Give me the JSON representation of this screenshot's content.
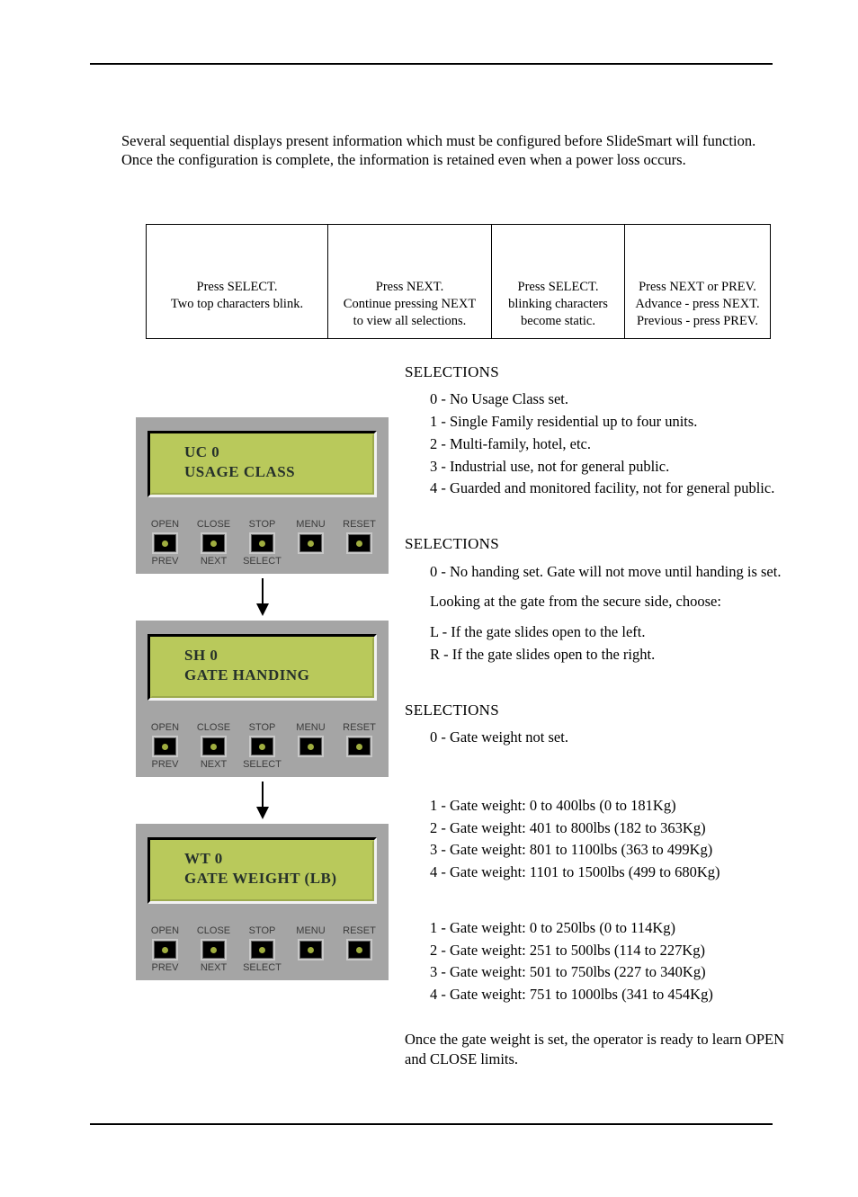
{
  "intro": "Several sequential displays present information which must be configured before SlideSmart will function. Once the configuration is complete, the information is retained even when a power loss occurs.",
  "flow": {
    "c1_l1": "Press SELECT.",
    "c1_l2": "Two top characters blink.",
    "c2_l1": "Press NEXT.",
    "c2_l2": "Continue pressing NEXT",
    "c2_l3": "to view all selections.",
    "c3_l1": "Press SELECT.",
    "c3_l2": "blinking characters",
    "c3_l3": "become static.",
    "c4_l1": "Press NEXT or PREV.",
    "c4_l2": "Advance - press NEXT.",
    "c4_l3": "Previous - press PREV."
  },
  "panels": [
    {
      "line1": "UC  0",
      "line2": "USAGE CLASS"
    },
    {
      "line1": "SH  0",
      "line2": "GATE HANDING"
    },
    {
      "line1": "WT  0",
      "line2": "GATE WEIGHT  (LB)"
    }
  ],
  "buttons": {
    "top": [
      "OPEN",
      "CLOSE",
      "STOP",
      "MENU",
      "RESET"
    ],
    "bot": [
      "PREV",
      "NEXT",
      "SELECT",
      "",
      ""
    ]
  },
  "selections": {
    "usage": {
      "head": "SELECTIONS",
      "items": [
        "0 - No Usage Class set.",
        "1 - Single Family residential up to four units.",
        "2 - Multi-family, hotel, etc.",
        "3 - Industrial use, not for general public.",
        "4 - Guarded and monitored facility, not for general public."
      ]
    },
    "handing": {
      "head": "SELECTIONS",
      "p0": "0 - No handing set. Gate will not move until handing is set.",
      "p1": "Looking at the gate from the secure side, choose:",
      "pL": "L - If the gate slides open to the left.",
      "pR": "R - If the gate slides open to the right."
    },
    "weight": {
      "head": "SELECTIONS",
      "p0": "0 - Gate weight not set.",
      "group1": [
        "1 - Gate weight: 0 to 400lbs (0 to 181Kg)",
        "2 - Gate weight: 401 to 800lbs (182 to 363Kg)",
        "3 - Gate weight: 801 to 1100lbs (363 to 499Kg)",
        "4 - Gate weight: 1101 to 1500lbs (499 to 680Kg)"
      ],
      "group2": [
        "1 - Gate weight: 0 to 250lbs (0 to 114Kg)",
        "2 - Gate weight: 251 to 500lbs (114 to 227Kg)",
        "3 - Gate weight: 501 to 750lbs (227 to 340Kg)",
        "4 - Gate weight: 751 to 1000lbs (341 to 454Kg)"
      ],
      "footer": "Once the gate weight is set, the operator is ready to learn OPEN and CLOSE limits."
    }
  }
}
